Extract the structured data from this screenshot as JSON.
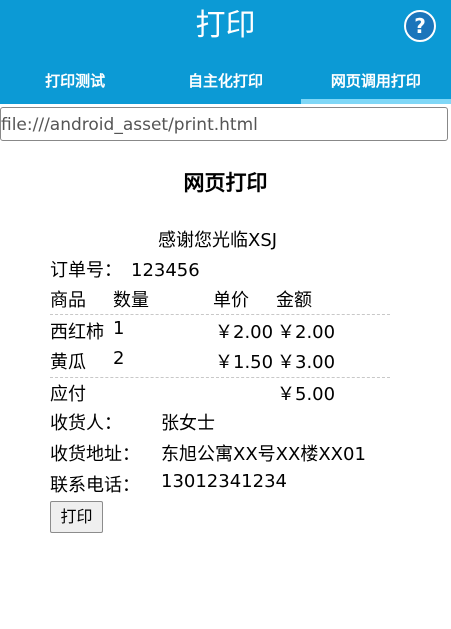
{
  "app": {
    "title": "打印",
    "help_glyph": "?"
  },
  "tabs": [
    {
      "label": "打印测试",
      "active": false
    },
    {
      "label": "自主化打印",
      "active": false
    },
    {
      "label": "网页调用打印",
      "active": true
    }
  ],
  "colors": {
    "appbar": "#0c9ad5",
    "tab_indicator": "#7fd7f7",
    "help_button": "#1b75bb"
  },
  "url": {
    "value": "file:///android_asset/print.html"
  },
  "page": {
    "heading": "网页打印",
    "thanks": "感谢您光临XSJ",
    "order_label": "订单号：",
    "order_no": "123456",
    "columns": {
      "item": "商品",
      "qty": "数量",
      "price": "单价",
      "amount": "金额"
    },
    "items": [
      {
        "name": "西红柿",
        "qty": "1",
        "price": "￥2.00",
        "amount": "￥2.00"
      },
      {
        "name": "黄瓜",
        "qty": "2",
        "price": "￥1.50",
        "amount": "￥3.00"
      }
    ],
    "total_label": "应付",
    "total_value": "￥5.00",
    "receiver_label": "收货人：",
    "receiver_value": "张女士",
    "address_label": "收货地址：",
    "address_value": "东旭公寓XX号XX楼XX01",
    "phone_label": "联系电话：",
    "phone_value": "13012341234",
    "print_button": "打印"
  }
}
